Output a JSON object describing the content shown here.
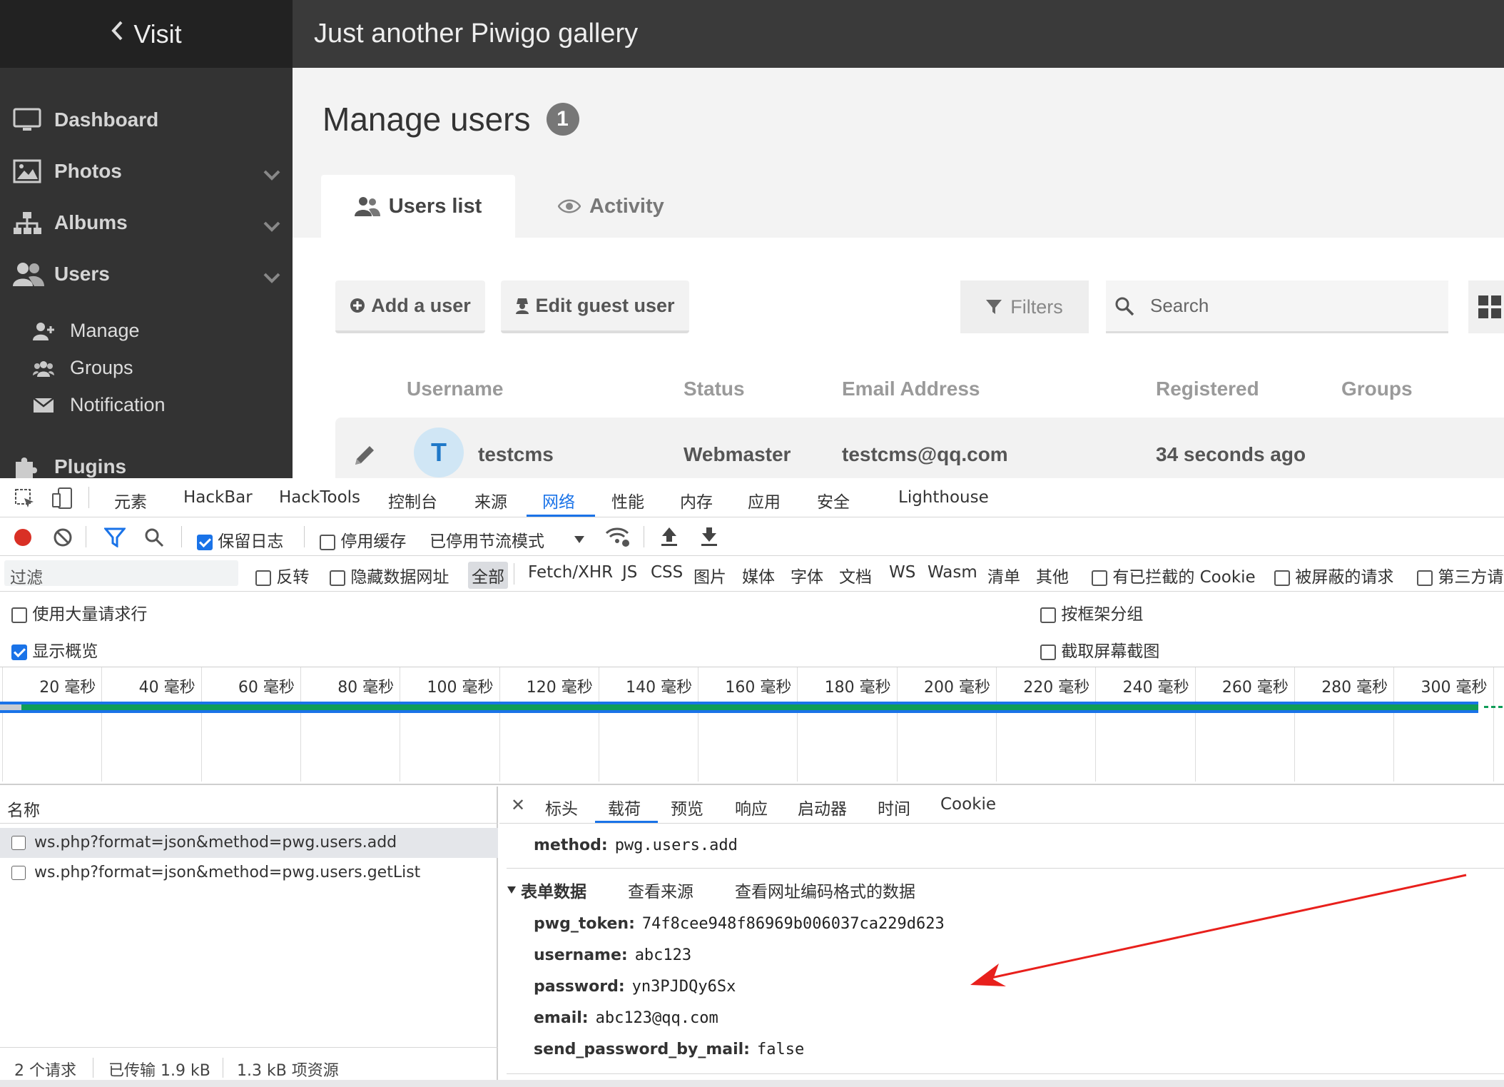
{
  "piwigo": {
    "visit_label": "Visit",
    "site_title": "Just another Piwigo gallery",
    "nav": {
      "dashboard": "Dashboard",
      "photos": "Photos",
      "albums": "Albums",
      "users": "Users",
      "plugins": "Plugins",
      "users_sub": {
        "manage": "Manage",
        "groups": "Groups",
        "notification": "Notification"
      }
    },
    "page_title": "Manage users",
    "user_count": "1",
    "tabs": {
      "users_list": "Users list",
      "activity": "Activity"
    },
    "buttons": {
      "add_user": "Add a user",
      "edit_guest": "Edit guest user",
      "filters": "Filters"
    },
    "search_placeholder": "Search",
    "columns": {
      "username": "Username",
      "status": "Status",
      "email": "Email Address",
      "registered": "Registered",
      "groups": "Groups"
    },
    "user_row": {
      "avatar_letter": "T",
      "username": "testcms",
      "status": "Webmaster",
      "email": "testcms@qq.com",
      "registered": "34 seconds ago"
    }
  },
  "devtools": {
    "tabs": [
      "元素",
      "HackBar",
      "HackTools",
      "控制台",
      "来源",
      "网络",
      "性能",
      "内存",
      "应用",
      "安全",
      "Lighthouse"
    ],
    "toolbar": {
      "preserve_log": "保留日志",
      "disable_cache": "停用缓存",
      "throttling": "已停用节流模式"
    },
    "filter": {
      "placeholder": "过滤",
      "invert": "反转",
      "hide_data_urls": "隐藏数据网址",
      "all": "全部",
      "types": [
        "Fetch/XHR",
        "JS",
        "CSS",
        "图片",
        "媒体",
        "字体",
        "文档",
        "WS",
        "Wasm",
        "清单",
        "其他"
      ],
      "blocked_cookies": "有已拦截的 Cookie",
      "blocked_requests": "被屏蔽的请求",
      "third_party": "第三方请"
    },
    "options": {
      "big_rows": "使用大量请求行",
      "group_by_frame": "按框架分组",
      "show_overview": "显示概览",
      "capture_screenshots": "截取屏幕截图"
    },
    "timeline_ticks": [
      "20 毫秒",
      "40 毫秒",
      "60 毫秒",
      "80 毫秒",
      "100 毫秒",
      "120 毫秒",
      "140 毫秒",
      "160 毫秒",
      "180 毫秒",
      "200 毫秒",
      "220 毫秒",
      "240 毫秒",
      "260 毫秒",
      "280 毫秒",
      "300 毫秒"
    ],
    "request_list": {
      "name_header": "名称",
      "rows": [
        "ws.php?format=json&method=pwg.users.add",
        "ws.php?format=json&method=pwg.users.getList"
      ]
    },
    "status": {
      "requests": "2 个请求",
      "transferred": "已传输 1.9 kB",
      "resources": "1.3 kB 项资源"
    },
    "detail_tabs": [
      "标头",
      "载荷",
      "预览",
      "响应",
      "启动器",
      "时间",
      "Cookie"
    ],
    "payload": {
      "method_key": "method:",
      "method_value": "pwg.users.add",
      "form_data_title": "表单数据",
      "view_source": "查看来源",
      "view_url_encoded": "查看网址编码格式的数据",
      "fields": [
        {
          "key": "pwg_token:",
          "value": "74f8cee948f86969b006037ca229d623"
        },
        {
          "key": "username:",
          "value": "abc123"
        },
        {
          "key": "password:",
          "value": "yn3PJDQy6Sx"
        },
        {
          "key": "email:",
          "value": "abc123@qq.com"
        },
        {
          "key": "send_password_by_mail:",
          "value": "false"
        }
      ]
    }
  }
}
